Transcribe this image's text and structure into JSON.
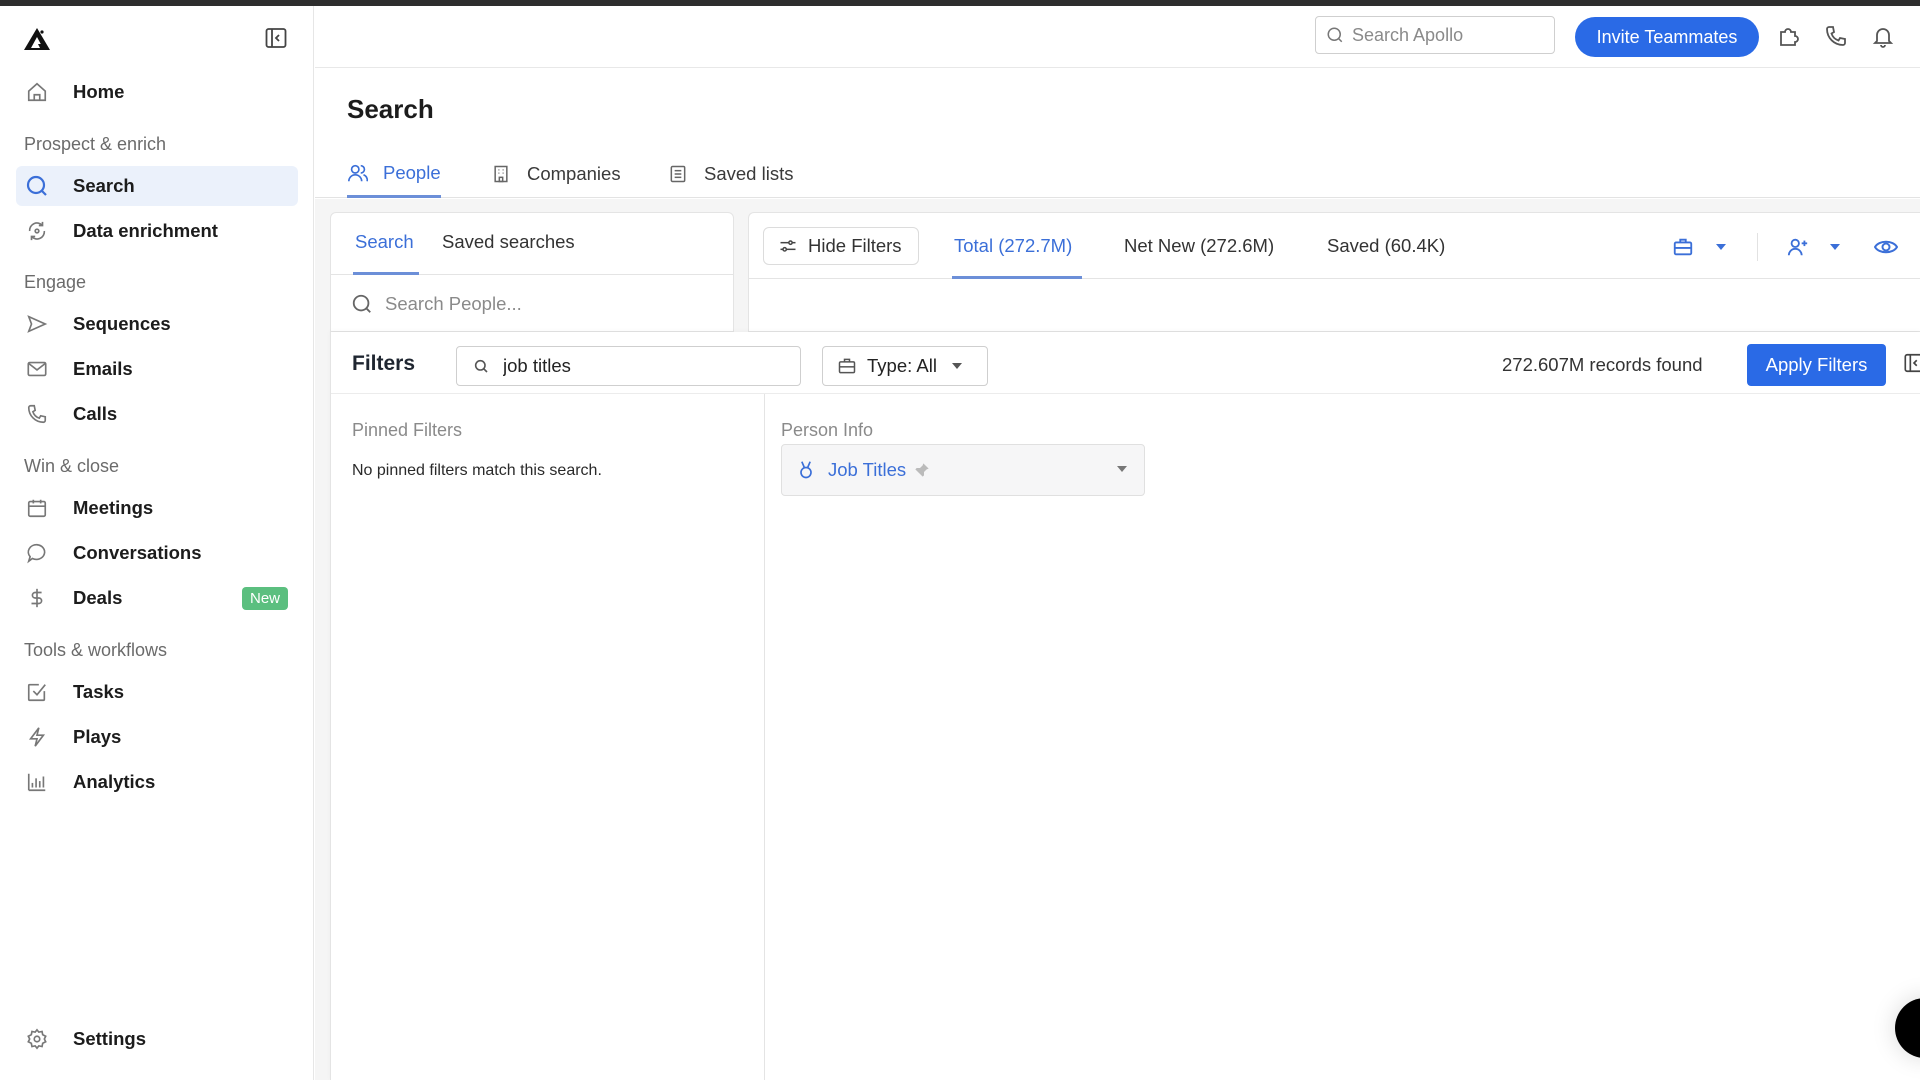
{
  "sidebar": {
    "home": "Home",
    "sections": [
      {
        "label": "Prospect & enrich"
      },
      {
        "label": "Engage"
      },
      {
        "label": "Win & close"
      },
      {
        "label": "Tools & workflows"
      }
    ],
    "items": {
      "search": "Search",
      "data_enrichment": "Data enrichment",
      "sequences": "Sequences",
      "emails": "Emails",
      "calls": "Calls",
      "meetings": "Meetings",
      "conversations": "Conversations",
      "deals": "Deals",
      "deals_badge": "New",
      "tasks": "Tasks",
      "plays": "Plays",
      "analytics": "Analytics",
      "settings": "Settings"
    },
    "active": "search"
  },
  "header": {
    "search_placeholder": "Search Apollo",
    "invite_label": "Invite Teammates",
    "icons": [
      "extension-icon",
      "phone-icon",
      "bell-icon"
    ]
  },
  "page": {
    "title": "Search",
    "tabs": [
      {
        "label": "People",
        "icon": "people-icon",
        "active": true
      },
      {
        "label": "Companies",
        "icon": "building-icon",
        "active": false
      },
      {
        "label": "Saved lists",
        "icon": "list-icon",
        "active": false
      }
    ]
  },
  "search_panel": {
    "tabs": [
      {
        "label": "Search",
        "active": true
      },
      {
        "label": "Saved searches",
        "active": false
      }
    ],
    "search_placeholder": "Search People..."
  },
  "results": {
    "hide_filters_label": "Hide Filters",
    "tabs": [
      {
        "label": "Total (272.7M)",
        "active": true
      },
      {
        "label": "Net New (272.6M)",
        "active": false
      },
      {
        "label": "Saved (60.4K)",
        "active": false
      }
    ]
  },
  "filters": {
    "title": "Filters",
    "search_value": "job titles",
    "type_label": "Type: All",
    "records_found": "272.607M records found",
    "apply_label": "Apply Filters",
    "pinned_title": "Pinned Filters",
    "pinned_empty": "No pinned filters match this search.",
    "person_info_title": "Person Info",
    "job_titles_label": "Job Titles"
  },
  "colors": {
    "accent": "#2a6ae6",
    "active_text": "#3b6fd8",
    "badge_green": "#5bbf7f",
    "active_nav_bg": "#ebf1fb"
  }
}
